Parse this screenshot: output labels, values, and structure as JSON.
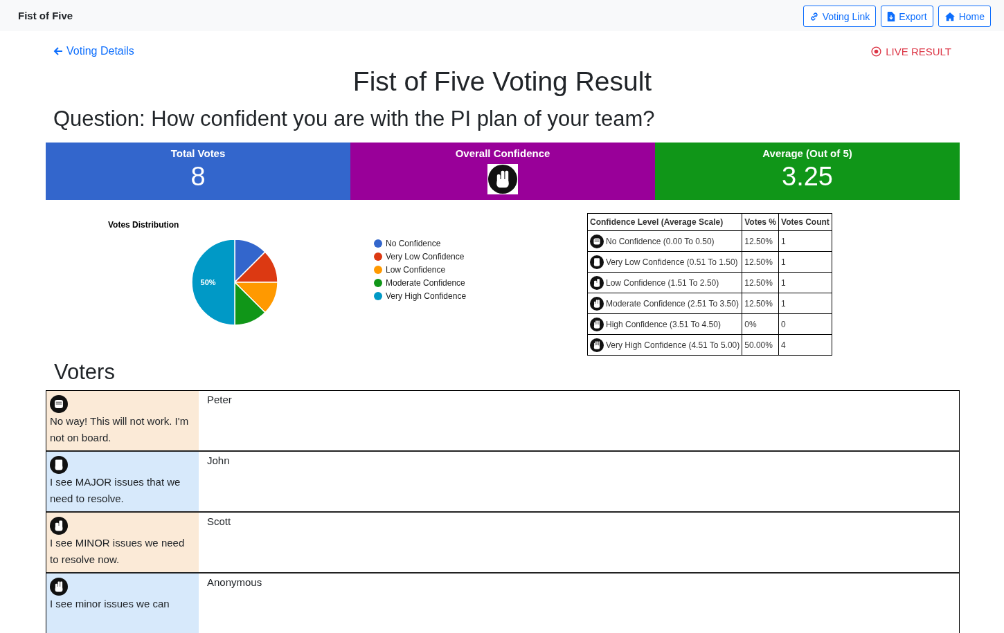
{
  "navbar": {
    "title": "Fist of Five",
    "buttons": [
      {
        "label": "Voting Link",
        "kind": "link"
      },
      {
        "label": "Export",
        "kind": "export"
      },
      {
        "label": "Home",
        "kind": "home"
      }
    ]
  },
  "back_link": "Voting Details",
  "live_badge": "LIVE RESULT",
  "title": "Fist of Five Voting Result",
  "question": "Question: How confident you are with the PI plan of your team?",
  "stats": [
    {
      "label": "Total Votes",
      "kind": "number",
      "value": "8",
      "color": "#3366cc"
    },
    {
      "label": "Overall Confidence",
      "kind": "three",
      "color": "#990099"
    },
    {
      "label": "Average (Out of 5)",
      "kind": "number",
      "value": "3.25",
      "color": "#109618"
    }
  ],
  "chart": {
    "chart_data": {
      "type": "pie",
      "title": "Votes Distribution",
      "categories": [
        "No Confidence",
        "Very Low Confidence",
        "Low Confidence",
        "Moderate Confidence",
        "Very High Confidence"
      ],
      "colors": [
        "#3366cc",
        "#dc3912",
        "#ff9900",
        "#109618",
        "#0099c6"
      ],
      "values": [
        12.5,
        12.5,
        12.5,
        12.5,
        50
      ],
      "value_labels": [
        null,
        null,
        null,
        null,
        "50%"
      ],
      "legend": "right"
    }
  },
  "levels": {
    "columns": [
      "Confidence Level (Average Scale)",
      "Votes %",
      "Votes Count"
    ],
    "rows": [
      {
        "kind": "zero",
        "label": "No Confidence (0.00 To 0.50)",
        "percent": "12.50%",
        "count": "1"
      },
      {
        "kind": "one",
        "label": "Very Low Confidence (0.51 To 1.50)",
        "percent": "12.50%",
        "count": "1"
      },
      {
        "kind": "two",
        "label": "Low Confidence (1.51 To 2.50)",
        "percent": "12.50%",
        "count": "1"
      },
      {
        "kind": "three",
        "label": "Moderate Confidence (2.51 To 3.50)",
        "percent": "12.50%",
        "count": "1"
      },
      {
        "kind": "four",
        "label": "High Confidence (3.51 To 4.50)",
        "percent": "0%",
        "count": "0"
      },
      {
        "kind": "five",
        "label": "Very High Confidence (4.51 To 5.00)",
        "percent": "50.00%",
        "count": "4"
      }
    ]
  },
  "voters": {
    "title": "Voters",
    "rows": [
      {
        "kind": "zero",
        "comment": "No way! This will not work. I'm not on board.",
        "name": "Peter"
      },
      {
        "kind": "one",
        "comment": "I see MAJOR issues that we need to resolve.",
        "name": "John"
      },
      {
        "kind": "two",
        "comment": "I see MINOR issues we need to resolve now.",
        "name": "Scott"
      },
      {
        "kind": "three",
        "comment": "I see minor issues we can",
        "name": "Anonymous"
      }
    ]
  }
}
